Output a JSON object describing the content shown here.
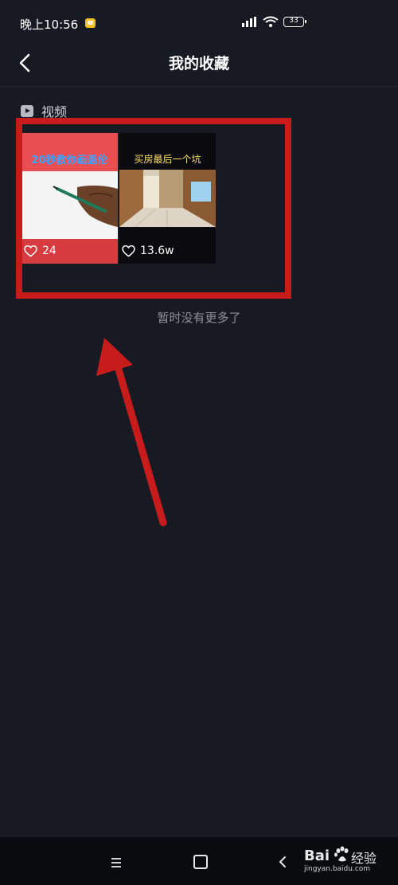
{
  "status_bar": {
    "time": "晚上10:56",
    "battery": "33",
    "icons": [
      "notification-icon",
      "signal-icon",
      "wifi-icon",
      "battery-icon"
    ]
  },
  "header": {
    "title": "我的收藏",
    "back_icon": "chevron-left-icon"
  },
  "section": {
    "label": "视频",
    "icon": "play-icon"
  },
  "videos": [
    {
      "title": "20秒教你画盖伦",
      "likes": "24",
      "heart_icon": "heart-outline-icon"
    },
    {
      "title": "买房最后一个坑",
      "likes": "13.6w",
      "heart_icon": "heart-outline-icon"
    }
  ],
  "footer_text": "暂时没有更多了",
  "annotation": {
    "color": "#c81c1c"
  },
  "nav_bar": {
    "menu_icon": "menu-icon",
    "home_icon": "home-square-icon",
    "back_icon": "back-triangle-icon"
  },
  "watermark": {
    "brand": "Bai",
    "brand_cn": "经验",
    "url": "jingyan.baidu.com"
  },
  "colors": {
    "background": "#171a23",
    "card1": "#d63b3f",
    "card2": "#0b0b0f",
    "title_text": "#ffffff",
    "muted_text": "#8d9099"
  }
}
